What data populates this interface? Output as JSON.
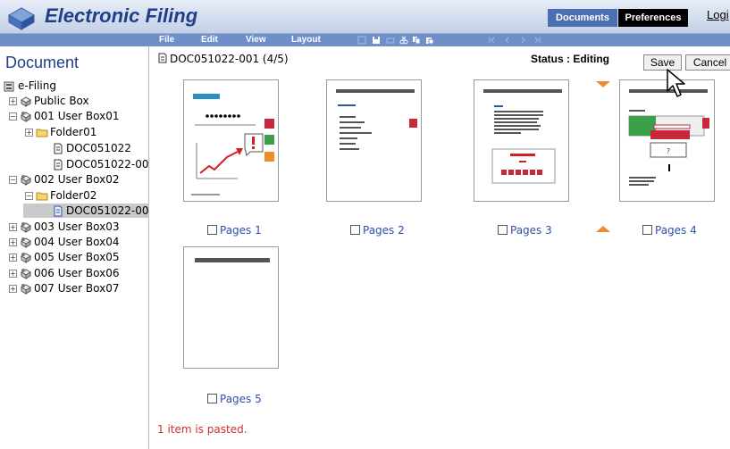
{
  "header": {
    "app_title": "Electronic Filing",
    "tab_documents": "Documents",
    "tab_preferences": "Preferences",
    "login": "Logi"
  },
  "menu": {
    "file": "File",
    "edit": "Edit",
    "view": "View",
    "layout": "Layout"
  },
  "sidebar": {
    "heading": "Document",
    "root": "e-Filing",
    "items": [
      {
        "label": "Public Box"
      },
      {
        "label": "001 User Box01"
      },
      {
        "label": "Folder01"
      },
      {
        "label": "DOC051022"
      },
      {
        "label": "DOC051022-00"
      },
      {
        "label": "002 User Box02"
      },
      {
        "label": "Folder02"
      },
      {
        "label": "DOC051022-00"
      },
      {
        "label": "003 User Box03"
      },
      {
        "label": "004 User Box04"
      },
      {
        "label": "005 User Box05"
      },
      {
        "label": "006 User Box06"
      },
      {
        "label": "007 User Box07"
      }
    ]
  },
  "document": {
    "name": "DOC051022-001  (4/5)",
    "status": "Status : Editing",
    "save": "Save",
    "cancel": "Cancel"
  },
  "pages": [
    {
      "label": "Pages 1"
    },
    {
      "label": "Pages 2"
    },
    {
      "label": "Pages 3"
    },
    {
      "label": "Pages 4"
    },
    {
      "label": "Pages 5"
    }
  ],
  "message": "1 item is pasted.",
  "colors": {
    "brand_blue": "#1f3f88",
    "menubar": "#6f8fc9",
    "insert_arrow": "#f08c2c",
    "message_red": "#d03030"
  }
}
